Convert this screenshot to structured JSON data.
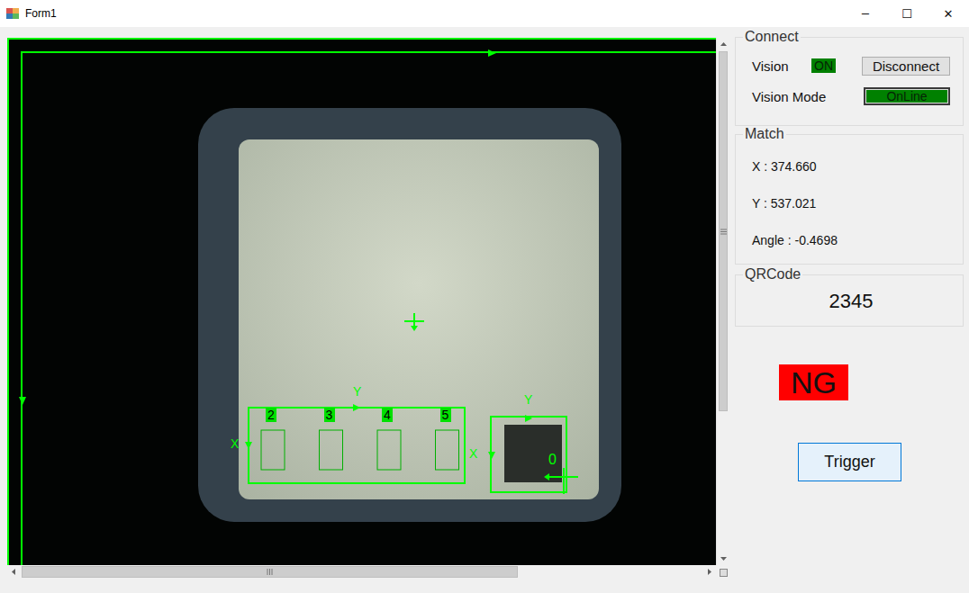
{
  "window": {
    "title": "Form1",
    "controls": [
      "─",
      "☐",
      "✕"
    ]
  },
  "viewer": {
    "overlay": {
      "ocr_labels": [
        {
          "text": "2"
        },
        {
          "text": "3"
        },
        {
          "text": "4"
        },
        {
          "text": "5"
        }
      ],
      "ocr_axis": {
        "x": "X",
        "y": "Y"
      },
      "code_axis": {
        "x": "X",
        "y": "Y"
      },
      "code_index": "0"
    },
    "scroll": {
      "vertical": {
        "offset": 0,
        "size": 0.72
      },
      "horizontal": {
        "offset": 0,
        "size": 0.73
      }
    }
  },
  "connect": {
    "title": "Connect",
    "rows": [
      {
        "label": "Vision",
        "status": "ON",
        "on": true,
        "framed": false,
        "button": "Disconnect"
      },
      {
        "label": "Vision Mode",
        "status": "OnLine",
        "on": true,
        "framed": true,
        "button": ""
      }
    ]
  },
  "match": {
    "title": "Match",
    "rows": [
      "X : 374.660",
      "Y : 537.021",
      "Angle : -0.4698"
    ]
  },
  "qrcode": {
    "title": "QRCode",
    "value": "2345"
  },
  "result": {
    "text": "NG",
    "pass": false
  },
  "trigger": {
    "label": "Trigger"
  }
}
